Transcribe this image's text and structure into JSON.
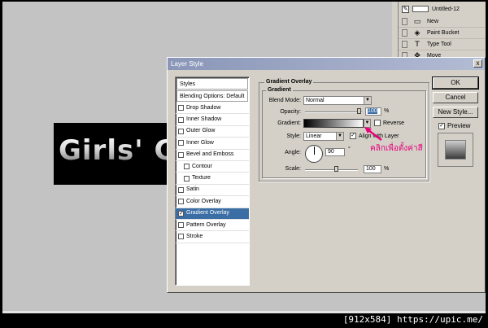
{
  "canvas": {
    "text": "Girls' G"
  },
  "document_tab": {
    "title": "Untitled-12"
  },
  "history": {
    "items": [
      {
        "label": "New",
        "icon": "new-document-icon",
        "glyph": "▭"
      },
      {
        "label": "Paint Bucket",
        "icon": "paint-bucket-icon",
        "glyph": "◈"
      },
      {
        "label": "Type Tool",
        "icon": "type-tool-icon",
        "glyph": "T"
      },
      {
        "label": "Move",
        "icon": "move-tool-icon",
        "glyph": "✥"
      }
    ]
  },
  "dialog": {
    "title": "Layer Style",
    "close_label": "x",
    "styles_header": "Styles",
    "blending_options": "Blending Options: Default",
    "effects": [
      {
        "label": "Drop Shadow",
        "checked": false,
        "indent": false,
        "active": false
      },
      {
        "label": "Inner Shadow",
        "checked": false,
        "indent": false,
        "active": false
      },
      {
        "label": "Outer Glow",
        "checked": false,
        "indent": false,
        "active": false
      },
      {
        "label": "Inner Glow",
        "checked": false,
        "indent": false,
        "active": false
      },
      {
        "label": "Bevel and Emboss",
        "checked": false,
        "indent": false,
        "active": false
      },
      {
        "label": "Contour",
        "checked": false,
        "indent": true,
        "active": false
      },
      {
        "label": "Texture",
        "checked": false,
        "indent": true,
        "active": false
      },
      {
        "label": "Satin",
        "checked": false,
        "indent": false,
        "active": false
      },
      {
        "label": "Color Overlay",
        "checked": false,
        "indent": false,
        "active": false
      },
      {
        "label": "Gradient Overlay",
        "checked": true,
        "indent": false,
        "active": true
      },
      {
        "label": "Pattern Overlay",
        "checked": false,
        "indent": false,
        "active": false
      },
      {
        "label": "Stroke",
        "checked": false,
        "indent": false,
        "active": false
      }
    ],
    "section_title": "Gradient Overlay",
    "subsection_title": "Gradient",
    "blend_mode_label": "Blend Mode:",
    "blend_mode_value": "Normal",
    "opacity_label": "Opacity:",
    "opacity_value": "100",
    "opacity_unit": "%",
    "gradient_label": "Gradient:",
    "reverse_label": "Reverse",
    "style_label": "Style:",
    "style_value": "Linear",
    "align_label": "Align with Layer",
    "angle_label": "Angle:",
    "angle_value": "90",
    "angle_unit": "°",
    "scale_label": "Scale:",
    "scale_value": "100",
    "scale_unit": "%",
    "ok_label": "OK",
    "cancel_label": "Cancel",
    "new_style_label": "New Style...",
    "preview_label": "Preview",
    "preview_checked": true
  },
  "annotation": {
    "text": "คลิกเพื่อตั้งค่าสี",
    "color": "#e8007a"
  },
  "watermark": "[912x584] https://upic.me/"
}
